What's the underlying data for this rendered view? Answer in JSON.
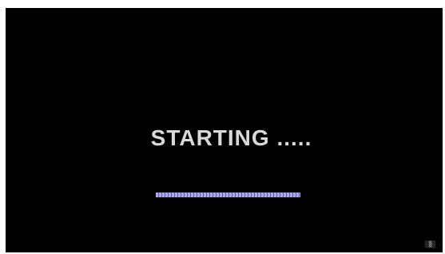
{
  "screen": {
    "status_text": "STARTING .....",
    "progress_fraction": 1.0,
    "background_color": "#000000",
    "text_color": "#d9d9d9",
    "progress_color": "#8f8fdc",
    "corner_logo_text": "░▒░"
  }
}
